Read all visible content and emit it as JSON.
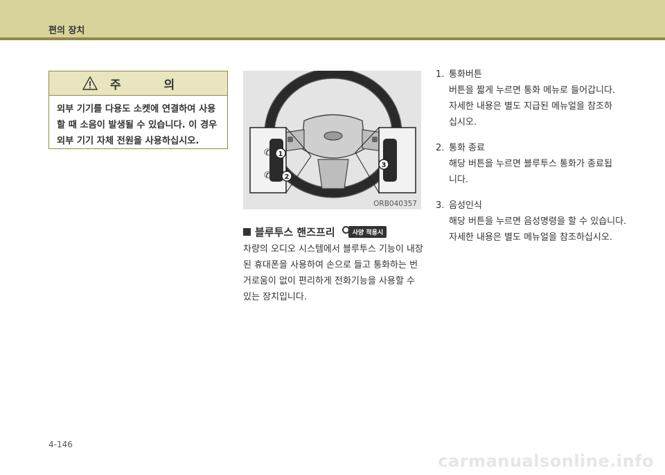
{
  "header": {
    "title": "편의 장치"
  },
  "caution": {
    "title": "주 의",
    "body": "외부 기기를 다용도 소켓에 연결하여 사용할 때 소음이 발생될 수 있습니다. 이 경우 외부 기기 자체 전원을 사용하십시오."
  },
  "figure": {
    "code": "ORB040357",
    "callouts": [
      "1",
      "2",
      "3"
    ]
  },
  "section": {
    "title": "블루투스 핸즈프리",
    "badge": "사양 적용시",
    "body": "차량의 오디오 시스템에서 블루투스 기능이 내장된 휴대폰을 사용하여 손으로 들고 통화하는 번거로움이 없이 편리하게 전화기능을 사용할 수 있는 장치입니다."
  },
  "items": [
    {
      "number": "1.",
      "title": "통화버튼",
      "lines": [
        "버튼을 짧게 누르면 통화 메뉴로 들어갑니다.",
        "자세한 내용은 별도 지급된 메뉴얼을 참조하",
        "십시오."
      ]
    },
    {
      "number": "2.",
      "title": "통화 종료",
      "lines": [
        "해당 버튼을 누르면 블루투스 통화가 종료됩",
        "니다."
      ]
    },
    {
      "number": "3.",
      "title": "음성인식",
      "lines": [
        "해당 버튼을 누르면 음성명령을 할 수 있습니다.",
        "자세한 내용은 별도 메뉴얼을 참조하십시오."
      ]
    }
  ],
  "footer": {
    "page_number": "4-146",
    "watermark": "carmanualsonline.info"
  }
}
